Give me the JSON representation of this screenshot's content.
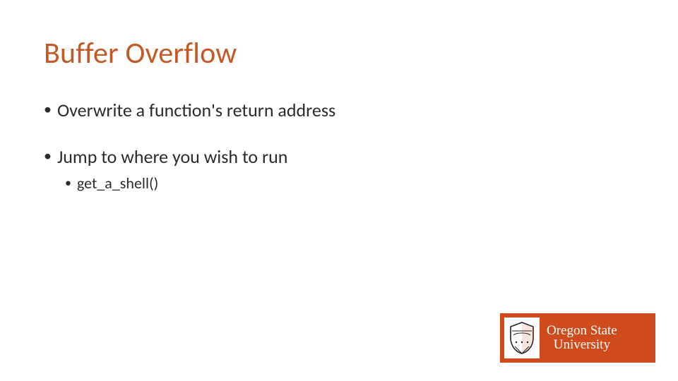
{
  "title": "Buffer Overflow",
  "bullets": {
    "b1": "Overwrite a function's return address",
    "b2": "Jump to where you wish to run",
    "b2_sub1": "get_a_shell()"
  },
  "logo": {
    "line1": "Oregon State",
    "line2": "University"
  },
  "colors": {
    "accent": "#c35a26",
    "logo_bg": "#cf4b1b"
  }
}
